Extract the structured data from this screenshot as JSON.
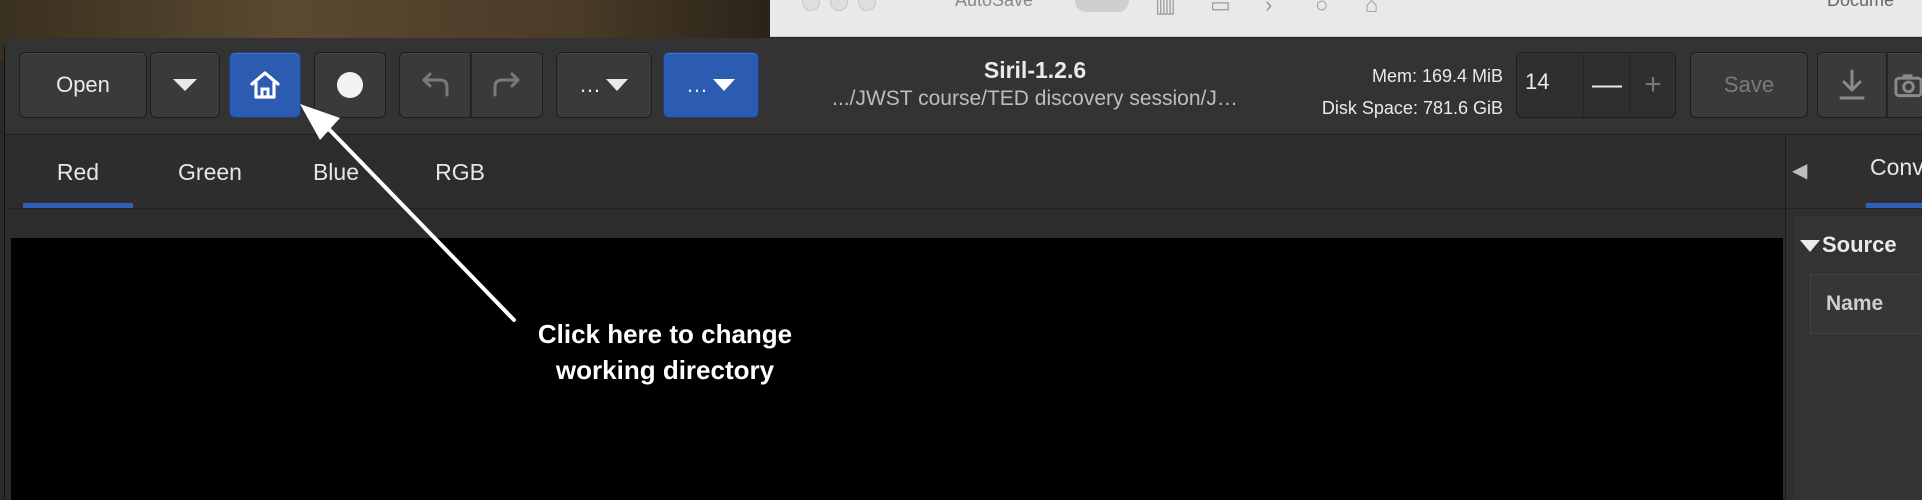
{
  "window_title": "Siril-1.2.6",
  "working_path": ".../JWST course/TED discovery session/J…",
  "toolbar": {
    "open_label": "Open",
    "more1_label": "…",
    "more2_label": "…",
    "save_label": "Save"
  },
  "memory": {
    "mem_label": "Mem: 169.4 MiB",
    "disk_label": "Disk Space: 781.6 GiB"
  },
  "zoom_spin": {
    "value": "14",
    "minus": "—",
    "plus": "+"
  },
  "tabs": [
    {
      "label": "Red",
      "active": true
    },
    {
      "label": "Green",
      "active": false
    },
    {
      "label": "Blue",
      "active": false
    },
    {
      "label": "RGB",
      "active": false
    }
  ],
  "right_panel": {
    "tab_label": "Conv",
    "section_label": "Source",
    "column_header": "Name"
  },
  "annotation": {
    "line1": "Click here to change",
    "line2": "working directory"
  },
  "background_window": {
    "autosave_label": "AutoSave",
    "doc_label": "Docume"
  },
  "colors": {
    "accent": "#2c5bb2",
    "tab_underline": "#2f5fb8",
    "panel_bg": "#333333",
    "canvas": "#000000"
  },
  "icons": {
    "home": "home-icon",
    "record": "circle-icon",
    "undo": "undo-icon",
    "redo": "redo-icon",
    "dropdown": "chevron-down-icon",
    "download": "download-icon",
    "camera": "camera-icon"
  }
}
